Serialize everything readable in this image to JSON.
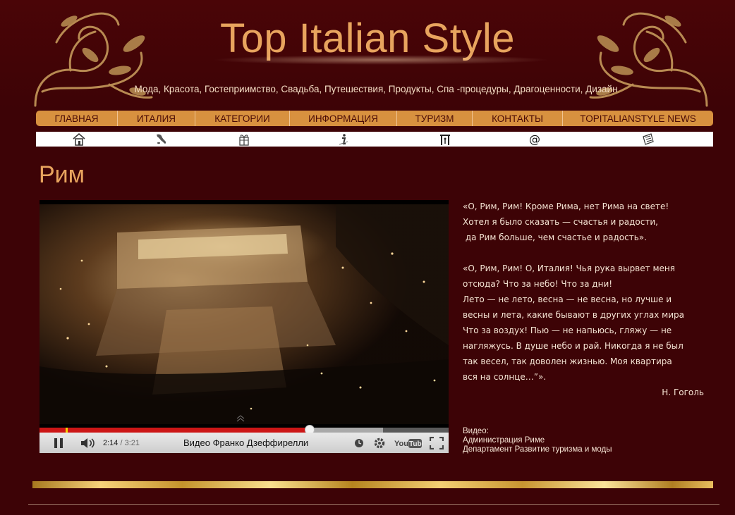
{
  "header": {
    "site_title": "Top Italian Style",
    "tagline": "Мода, Красота, Гостеприимство, Свадьба, Путешествия, Продукты, Спа -процедуры, Драгоценности, Дизайн"
  },
  "nav": {
    "items": [
      {
        "label": "ГЛАВНАЯ"
      },
      {
        "label": "ИТАЛИЯ"
      },
      {
        "label": "КАТЕГОРИИ"
      },
      {
        "label": "ИНФОРМАЦИЯ"
      },
      {
        "label": "ТУРИЗМ"
      },
      {
        "label": "КОНТАКТЫ"
      },
      {
        "label": "TOPITALIANSTYLE NEWS"
      }
    ]
  },
  "icon_bar": {
    "icons": [
      "home-icon",
      "italy-map-icon",
      "gift-icon",
      "info-icon",
      "tourism-gate-icon",
      "at-sign-icon",
      "newspaper-icon"
    ]
  },
  "page": {
    "title": "Рим"
  },
  "video": {
    "current_time": "2:14",
    "duration": "/ 3:21",
    "title": "Видео Франко Дзеффирелли",
    "progress_played": 0.66,
    "progress_buffered": 0.84,
    "youtube_logo": "YouTube"
  },
  "quote": {
    "p1": [
      "«О, Рим, Рим! Кроме Рима, нет Рима на свете!",
      "Хотел я было сказать — счастья и радости,",
      " да Рим больше, чем счастье и радость»."
    ],
    "p2": [
      "«О, Рим, Рим! О, Италия! Чья рука вырвет меня",
      "отсюда? Что за небо! Что за дни!",
      "Лето — не лето, весна — не весна, но лучше и",
      "весны и лета, какие бывают в других углах мира",
      "Что за воздух! Пью — не напьюсь, гляжу — не",
      "нагляжусь. В душе небо и рай. Никогда я не был",
      "так весел, так доволен жизнью. Моя квартира",
      "вся на солнце…”»."
    ],
    "author": "Н. Гоголь"
  },
  "credits": {
    "label": "Видео:",
    "line1": "Администрация Риме",
    "line2": "Департамент Развитие туризма и моды"
  },
  "colors": {
    "background": "#3d0306",
    "accent_orange": "#e8a45e",
    "nav_bg": "#d8913f",
    "nav_text": "#4a0b06",
    "progress_red": "#cc1616",
    "text_light": "#f6e4d4"
  }
}
